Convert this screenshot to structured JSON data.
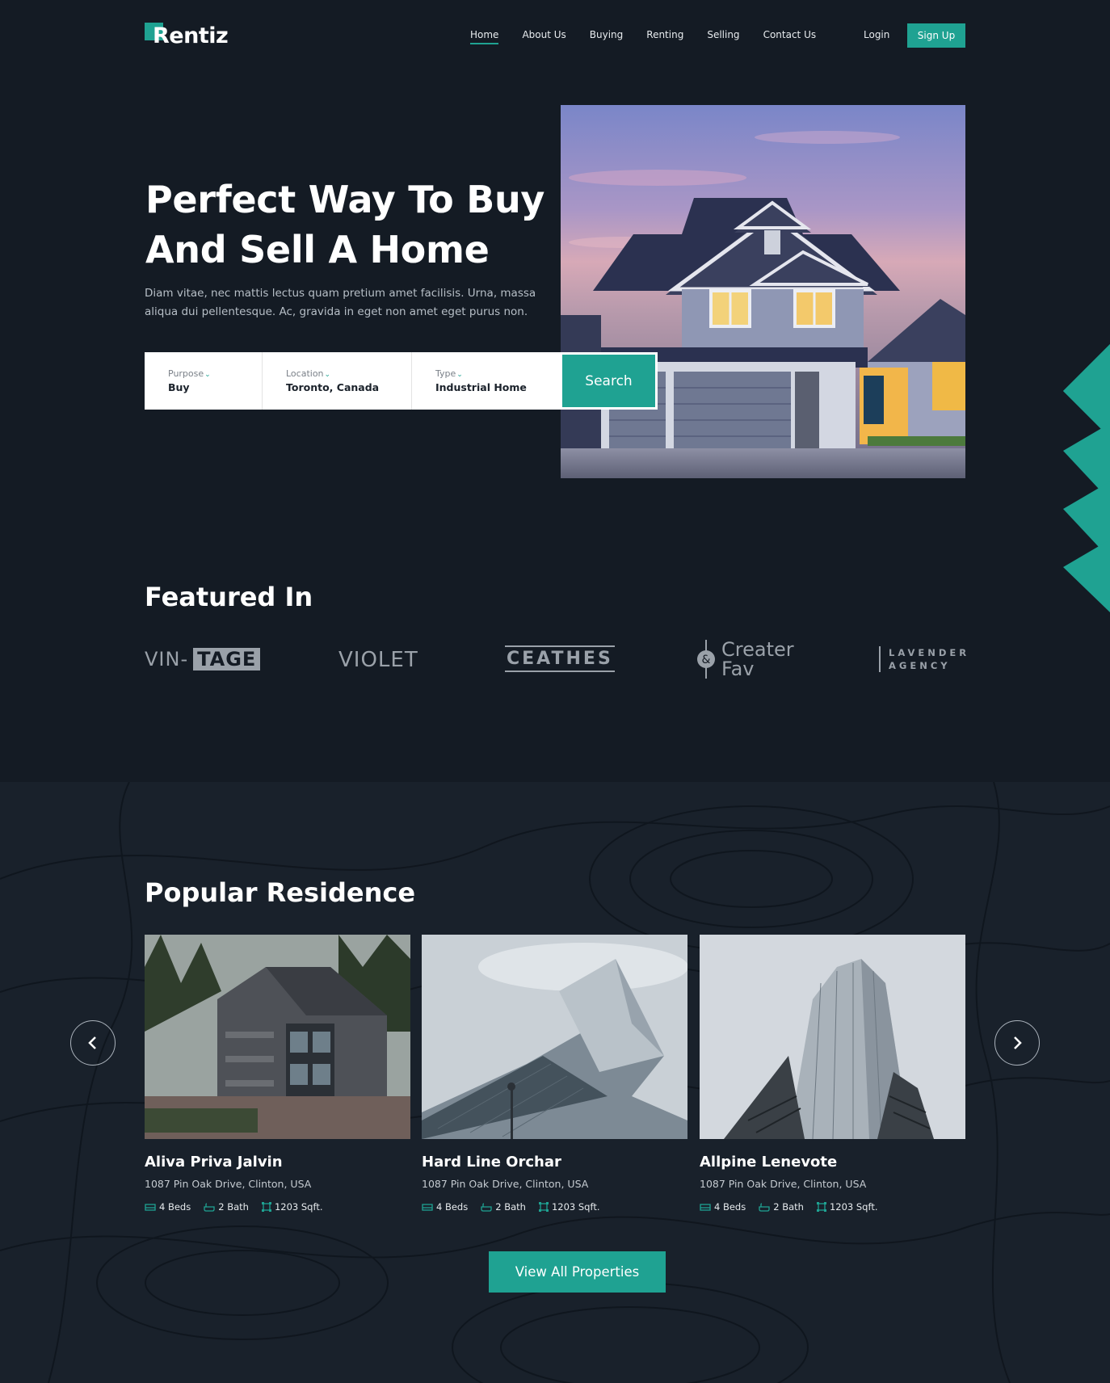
{
  "brand": {
    "name": "Rentiz",
    "accent": "#1fa292",
    "background": "#141b24"
  },
  "nav": {
    "items": [
      {
        "label": "Home",
        "active": true
      },
      {
        "label": "About Us"
      },
      {
        "label": "Buying"
      },
      {
        "label": "Renting"
      },
      {
        "label": "Selling"
      },
      {
        "label": "Contact Us"
      }
    ],
    "login": "Login",
    "signup": "Sign Up"
  },
  "hero": {
    "title_line1": "Perfect Way To Buy",
    "title_line2": "And Sell A Home",
    "description": "Diam vitae, nec mattis lectus quam pretium amet facilisis. Urna, massa aliqua dui pellentesque. Ac, gravida in eget non amet eget purus non.",
    "search": {
      "purpose": {
        "label": "Purpose",
        "value": "Buy"
      },
      "location": {
        "label": "Location",
        "value": "Toronto, Canada"
      },
      "type": {
        "label": "Type",
        "value": "Industrial Home"
      },
      "button": "Search"
    }
  },
  "featured": {
    "title": "Featured In",
    "logos": [
      {
        "name": "vintage",
        "text_a": "VIN-",
        "text_b": "TAGE"
      },
      {
        "name": "violet",
        "text": "VIOLET"
      },
      {
        "name": "ceathes",
        "text": "CEATHES"
      },
      {
        "name": "createrfav",
        "text_a": "Creater",
        "text_b": "Fav"
      },
      {
        "name": "lavender",
        "text_a": "LAVENDER",
        "text_b": "AGENCY"
      }
    ]
  },
  "popular": {
    "title": "Popular Residence",
    "properties": [
      {
        "name": "Aliva Priva Jalvin",
        "address": "1087 Pin Oak Drive, Clinton, USA",
        "beds": "4 Beds",
        "bath": "2 Bath",
        "area": "1203 Sqft."
      },
      {
        "name": "Hard Line Orchar",
        "address": "1087 Pin Oak Drive, Clinton, USA",
        "beds": "4 Beds",
        "bath": "2 Bath",
        "area": "1203 Sqft."
      },
      {
        "name": "Allpine Lenevote",
        "address": "1087 Pin Oak Drive, Clinton, USA",
        "beds": "4 Beds",
        "bath": "2 Bath",
        "area": "1203 Sqft."
      }
    ],
    "view_all": "View All Properties"
  }
}
